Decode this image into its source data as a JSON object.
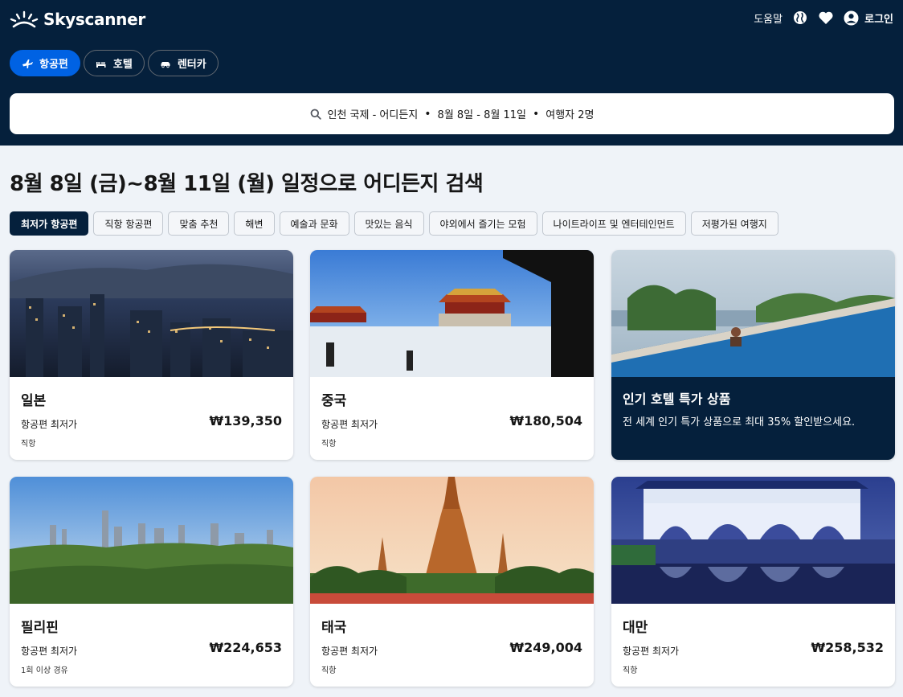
{
  "header": {
    "brand": "Skyscanner",
    "help": "도움말",
    "login": "로그인",
    "icons": [
      "globe-icon",
      "heart-icon",
      "user-icon"
    ]
  },
  "modes": [
    {
      "label": "항공편",
      "icon": "plane-icon",
      "active": true
    },
    {
      "label": "호텔",
      "icon": "bed-icon",
      "active": false
    },
    {
      "label": "렌터카",
      "icon": "car-icon",
      "active": false
    }
  ],
  "search": {
    "route": "인천 국제 - 어디든지",
    "dates": "8월 8일 - 8월 11일",
    "travelers": "여행자 2명",
    "separator": "•"
  },
  "headline": "8월 8일 (금)~8월 11일 (월) 일정으로 어디든지 검색",
  "filters": [
    {
      "label": "최저가 항공편",
      "active": true
    },
    {
      "label": "직항 항공편",
      "active": false
    },
    {
      "label": "맞춤 추천",
      "active": false
    },
    {
      "label": "해변",
      "active": false
    },
    {
      "label": "예술과 문화",
      "active": false
    },
    {
      "label": "맛있는 음식",
      "active": false
    },
    {
      "label": "야외에서 즐기는 모험",
      "active": false
    },
    {
      "label": "나이트라이프 및 엔터테인먼트",
      "active": false
    },
    {
      "label": "저평가된 여행지",
      "active": false
    }
  ],
  "destinations": [
    {
      "name": "일본",
      "price_label": "항공편 최저가",
      "price": "₩139,350",
      "stops": "직항"
    },
    {
      "name": "중국",
      "price_label": "항공편 최저가",
      "price": "₩180,504",
      "stops": "직항"
    },
    {
      "name": "필리핀",
      "price_label": "항공편 최저가",
      "price": "₩224,653",
      "stops": "1회 이상 경유"
    },
    {
      "name": "태국",
      "price_label": "항공편 최저가",
      "price": "₩249,004",
      "stops": "직항"
    },
    {
      "name": "대만",
      "price_label": "항공편 최저가",
      "price": "₩258,532",
      "stops": "직항"
    }
  ],
  "promo": {
    "title": "인기 호텔 특가 상품",
    "description": "전 세계 인기 특가 상품으로 최대 35% 할인받으세요."
  },
  "colors": {
    "navy": "#05203c",
    "blue": "#0062e3",
    "page_bg": "#eff3f8"
  }
}
